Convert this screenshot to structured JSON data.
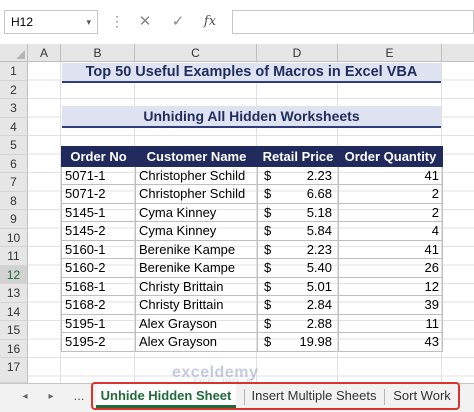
{
  "formula_bar": {
    "name_box": "H12",
    "name_box_arrow": "▾",
    "dots": "⋮",
    "cancel_icon": "✕",
    "enter_icon": "✓",
    "fx_label": "fx",
    "formula": ""
  },
  "columns": [
    "A",
    "B",
    "C",
    "D",
    "E"
  ],
  "rows": [
    "1",
    "2",
    "3",
    "4",
    "5",
    "6",
    "7",
    "8",
    "9",
    "10",
    "11",
    "12",
    "13",
    "14",
    "15",
    "16",
    "17"
  ],
  "selected_row": "12",
  "sheet": {
    "title": "Top 50 Useful Examples of Macros in Excel VBA",
    "subtitle": "Unhiding All Hidden Worksheets",
    "headers": [
      "Order No",
      "Customer Name",
      "Retail Price",
      "Order Quantity"
    ],
    "currency_symbol": "$",
    "rows": [
      {
        "order": "5071-1",
        "customer": "Christopher Schild",
        "price": "2.23",
        "qty": "41"
      },
      {
        "order": "5071-2",
        "customer": "Christopher Schild",
        "price": "6.68",
        "qty": "2"
      },
      {
        "order": "5145-1",
        "customer": "Cyma Kinney",
        "price": "5.18",
        "qty": "2"
      },
      {
        "order": "5145-2",
        "customer": "Cyma Kinney",
        "price": "5.84",
        "qty": "4"
      },
      {
        "order": "5160-1",
        "customer": "Berenike Kampe",
        "price": "2.23",
        "qty": "41"
      },
      {
        "order": "5160-2",
        "customer": "Berenike Kampe",
        "price": "5.40",
        "qty": "26"
      },
      {
        "order": "5168-1",
        "customer": "Christy Brittain",
        "price": "5.01",
        "qty": "12"
      },
      {
        "order": "5168-2",
        "customer": "Christy Brittain",
        "price": "2.84",
        "qty": "39"
      },
      {
        "order": "5195-1",
        "customer": "Alex Grayson",
        "price": "2.88",
        "qty": "11"
      },
      {
        "order": "5195-2",
        "customer": "Alex Grayson",
        "price": "19.98",
        "qty": "43"
      }
    ]
  },
  "tabs": {
    "nav_prev": "◂",
    "nav_next": "▸",
    "ellipsis": "...",
    "items": [
      "Unhide Hidden Sheet",
      "Insert Multiple Sheets",
      "Sort Work"
    ],
    "active": "Unhide Hidden Sheet"
  },
  "watermark": {
    "text": "exceldemy",
    "sub": "EXCEL · DATA · BI"
  },
  "colors": {
    "header_bg": "#202a5c",
    "banner_bg": "#dfe3f1",
    "active_tab": "#1e6a39",
    "highlight_box": "#d9342b"
  }
}
